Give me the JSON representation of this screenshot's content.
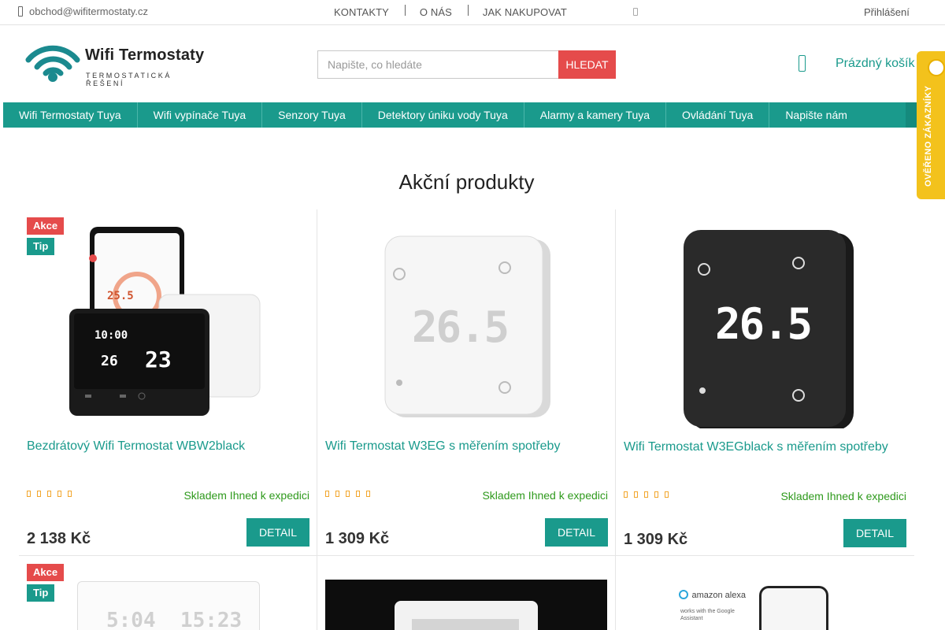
{
  "topbar": {
    "email": "obchod@wifitermostaty.cz",
    "links": [
      "KONTAKTY",
      "O NÁS",
      "JAK NAKUPOVAT"
    ],
    "login": "Přihlášení"
  },
  "header": {
    "logo_title": "Wifi Termostaty",
    "logo_subtitle": "TERMOSTATICKÁ ŘEŠENÍ",
    "search_placeholder": "Napište, co hledáte",
    "search_button": "HLEDAT",
    "cart_label": "Prázdný košík",
    "badge_text": "OVĚŘENO ZÁKAZNÍKY"
  },
  "nav": {
    "items": [
      "Wifi Termostaty Tuya",
      "Wifi vypínače Tuya",
      "Senzory Tuya",
      "Detektory úniku vody Tuya",
      "Alarmy a kamery Tuya",
      "Ovládání Tuya",
      "Napište nám"
    ]
  },
  "section": {
    "title": "Akční produkty"
  },
  "products": [
    {
      "name": "Bezdrátový Wifi Termostat WBW2black",
      "stock": "Skladem Ihned k expedici",
      "price": "2 138 Kč",
      "detail": "DETAIL",
      "flags": [
        "Akce",
        "Tip"
      ],
      "rating": 0,
      "display": {
        "time": "10:00",
        "room": "23",
        "set": "26",
        "phone": "25.5"
      }
    },
    {
      "name": "Wifi Termostat W3EG s měřením spotřeby",
      "stock": "Skladem Ihned k expedici",
      "price": "1 309 Kč",
      "detail": "DETAIL",
      "flags": [],
      "rating": 0,
      "display": {
        "temp": "26.5"
      }
    },
    {
      "name": "Wifi Termostat W3EGblack s měřením spotřeby",
      "stock": "Skladem Ihned k expedici",
      "price": "1 309 Kč",
      "detail": "DETAIL",
      "flags": [],
      "rating": 0,
      "display": {
        "temp": "26.5"
      }
    }
  ],
  "second_row": {
    "flags": [
      "Akce",
      "Tip"
    ],
    "display_digits": "5:04  15:23",
    "assistant_1": "amazon alexa",
    "assistant_2": "works with the Google Assistant"
  },
  "colors": {
    "accent": "#1a9a8c",
    "sale": "#e54b4b",
    "stock": "#2f9a1d",
    "badge": "#f3c21c"
  }
}
